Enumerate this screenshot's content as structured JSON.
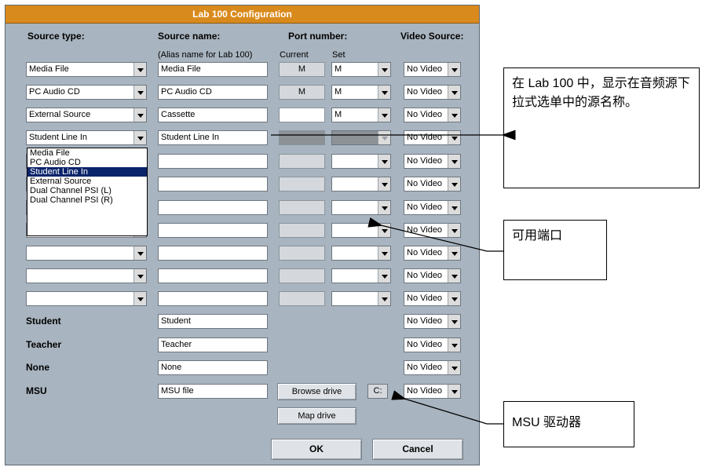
{
  "dialog": {
    "title": "Lab 100 Configuration",
    "headers": {
      "source_type": "Source type:",
      "source_name": "Source name:",
      "port_number": "Port number:",
      "video_source": "Video Source:"
    },
    "subheaders": {
      "alias": "(Alias name for Lab 100)",
      "current": "Current",
      "set": "Set"
    },
    "rows": [
      {
        "type": "Media File",
        "name": "Media File",
        "current": "M",
        "set": "M",
        "video": "No Video"
      },
      {
        "type": "PC Audio CD",
        "name": "PC Audio CD",
        "current": "M",
        "set": "M",
        "video": "No Video"
      },
      {
        "type": "External Source",
        "name": "Cassette",
        "current": "",
        "set": "M",
        "video": "No Video"
      },
      {
        "type": "Student Line In",
        "name": "Student Line In",
        "current": "",
        "set": "",
        "video": "No Video"
      },
      {
        "type": "",
        "name": "",
        "current": "",
        "set": "",
        "video": "No Video"
      },
      {
        "type": "",
        "name": "",
        "current": "",
        "set": "",
        "video": "No Video"
      },
      {
        "type": "",
        "name": "",
        "current": "",
        "set": "",
        "video": "No Video"
      },
      {
        "type": "",
        "name": "",
        "current": "",
        "set": "",
        "video": "No Video"
      },
      {
        "type": "",
        "name": "",
        "current": "",
        "set": "",
        "video": "No Video"
      },
      {
        "type": "",
        "name": "",
        "current": "",
        "set": "",
        "video": "No Video"
      },
      {
        "type": "",
        "name": "",
        "current": "",
        "set": "",
        "video": "No Video"
      }
    ],
    "fixed_rows": [
      {
        "label": "Student",
        "name": "Student",
        "video": "No Video"
      },
      {
        "label": "Teacher",
        "name": "Teacher",
        "video": "No Video"
      },
      {
        "label": "None",
        "name": "None",
        "video": "No Video"
      },
      {
        "label": "MSU",
        "name": "MSU file",
        "video": "No Video"
      }
    ],
    "dropdown_options": [
      "Media File",
      "PC Audio CD",
      "Student Line In",
      "External Source",
      "Dual Channel PSI (L)",
      "Dual Channel PSI (R)"
    ],
    "dropdown_selected": "Student Line In",
    "browse_drive_label": "Browse drive",
    "drive_value": "C:",
    "map_drive_label": "Map drive",
    "ok_label": "OK",
    "cancel_label": "Cancel"
  },
  "callouts": {
    "source_name": "在 Lab 100 中，显示在音频源下拉式选单中的源名称。",
    "ports": "可用端口",
    "msu": "MSU 驱动器"
  },
  "colors": {
    "title_bar": "#d98a1c",
    "dialog_bg": "#a8b4bf",
    "selection": "#0a246a"
  }
}
